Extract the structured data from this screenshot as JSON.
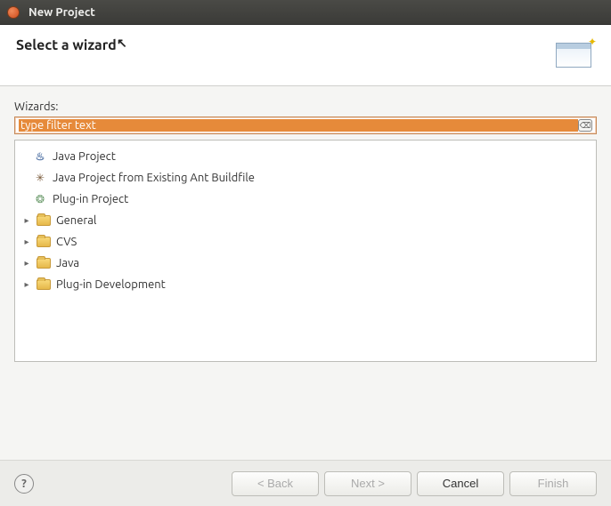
{
  "window": {
    "title": "New Project"
  },
  "header": {
    "title": "Select a wizard"
  },
  "filter": {
    "label": "Wizards:",
    "text": "type filter text"
  },
  "tree": {
    "items": [
      {
        "label": "Java Project",
        "type": "leaf",
        "icon": "java"
      },
      {
        "label": "Java Project from Existing Ant Buildfile",
        "type": "leaf",
        "icon": "ant"
      },
      {
        "label": "Plug-in Project",
        "type": "leaf",
        "icon": "plugin"
      },
      {
        "label": "General",
        "type": "folder"
      },
      {
        "label": "CVS",
        "type": "folder"
      },
      {
        "label": "Java",
        "type": "folder"
      },
      {
        "label": "Plug-in Development",
        "type": "folder"
      }
    ]
  },
  "buttons": {
    "back": "< Back",
    "next": "Next >",
    "cancel": "Cancel",
    "finish": "Finish"
  }
}
